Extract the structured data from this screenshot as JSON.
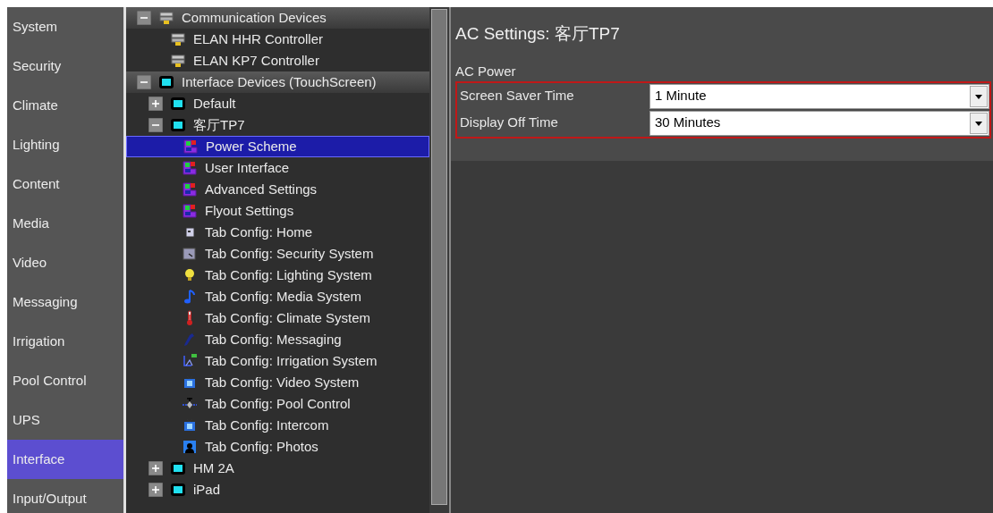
{
  "nav": [
    {
      "label": "System",
      "selected": false
    },
    {
      "label": "Security",
      "selected": false
    },
    {
      "label": "Climate",
      "selected": false
    },
    {
      "label": "Lighting",
      "selected": false
    },
    {
      "label": "Content",
      "selected": false
    },
    {
      "label": "Media",
      "selected": false
    },
    {
      "label": "Video",
      "selected": false
    },
    {
      "label": "Messaging",
      "selected": false
    },
    {
      "label": "Irrigation",
      "selected": false
    },
    {
      "label": "Pool Control",
      "selected": false
    },
    {
      "label": "UPS",
      "selected": false
    },
    {
      "label": "Interface",
      "selected": true
    },
    {
      "label": "Input/Output",
      "selected": false
    }
  ],
  "tree": [
    {
      "label": "Communication Devices",
      "kind": "server",
      "expanded": true,
      "selected": false,
      "children": [
        {
          "label": "ELAN HHR Controller",
          "kind": "server",
          "selected": false
        },
        {
          "label": "ELAN KP7 Controller",
          "kind": "server",
          "selected": false
        }
      ]
    },
    {
      "label": "Interface Devices (TouchScreen)",
      "kind": "screen",
      "expanded": true,
      "selected": false,
      "children": [
        {
          "label": "Default",
          "kind": "screen",
          "expanded": false,
          "selected": false
        },
        {
          "label": "客厅TP7",
          "kind": "screen",
          "expanded": true,
          "selected": false,
          "children": [
            {
              "label": "Power Scheme",
              "kind": "panel",
              "selected": true
            },
            {
              "label": "User Interface",
              "kind": "panel",
              "selected": false
            },
            {
              "label": "Advanced Settings",
              "kind": "panel",
              "selected": false
            },
            {
              "label": "Flyout Settings",
              "kind": "panel",
              "selected": false
            },
            {
              "label": "Tab Config: Home",
              "kind": "home",
              "selected": false
            },
            {
              "label": "Tab Config: Security System",
              "kind": "security",
              "selected": false
            },
            {
              "label": "Tab Config: Lighting System",
              "kind": "bulb",
              "selected": false
            },
            {
              "label": "Tab Config: Media System",
              "kind": "note",
              "selected": false
            },
            {
              "label": "Tab Config: Climate System",
              "kind": "thermometer",
              "selected": false
            },
            {
              "label": "Tab Config: Messaging",
              "kind": "phone",
              "selected": false
            },
            {
              "label": "Tab Config: Irrigation System",
              "kind": "irrigation",
              "selected": false
            },
            {
              "label": "Tab Config: Video System",
              "kind": "tv",
              "selected": false
            },
            {
              "label": "Tab Config: Pool Control",
              "kind": "pool",
              "selected": false
            },
            {
              "label": "Tab Config: Intercom",
              "kind": "tv",
              "selected": false
            },
            {
              "label": "Tab Config: Photos",
              "kind": "photo",
              "selected": false
            }
          ]
        },
        {
          "label": "HM 2A",
          "kind": "screen",
          "expanded": false,
          "selected": false
        },
        {
          "label": "iPad",
          "kind": "screen",
          "expanded": false,
          "selected": false
        }
      ]
    }
  ],
  "panel": {
    "title": "AC Settings: 客厅TP7",
    "section": "AC Power",
    "highlighted": true,
    "settings": [
      {
        "label": "Screen Saver Time",
        "value": "1 Minute"
      },
      {
        "label": "Display Off Time",
        "value": "30 Minutes"
      }
    ]
  }
}
